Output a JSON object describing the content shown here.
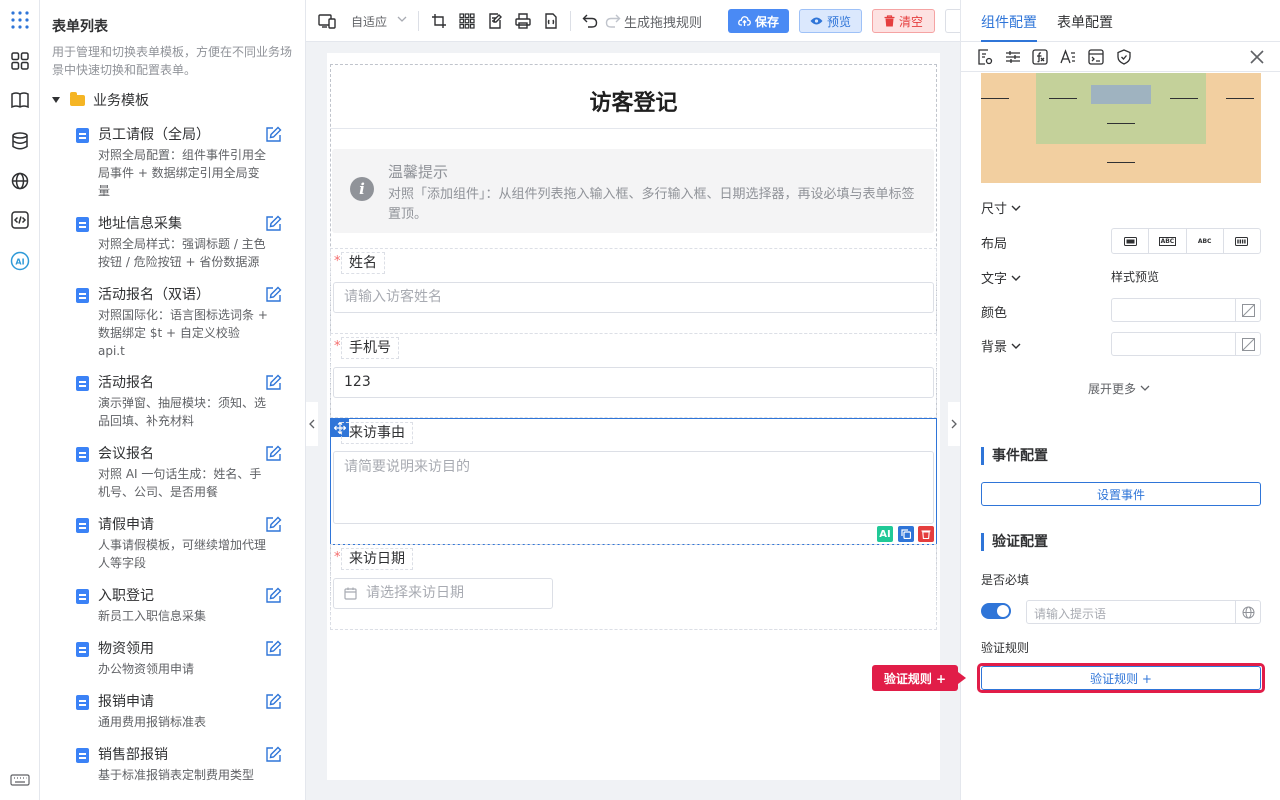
{
  "rail": {
    "icons": [
      "apps-grid-icon",
      "components-icon",
      "book-icon",
      "database-icon",
      "globe-icon",
      "code-icon",
      "ai-icon",
      "keyboard-icon"
    ],
    "ai_label": "AI"
  },
  "form_list": {
    "title": "表单列表",
    "description": "用于管理和切换表单模板，方便在不同业务场景中快速切换和配置表单。",
    "folder": "业务模板",
    "templates": [
      {
        "name": "员工请假（全局）",
        "desc": "对照全局配置：组件事件引用全局事件 + 数据绑定引用全局变量"
      },
      {
        "name": "地址信息采集",
        "desc": "对照全局样式：强调标题 / 主色按钮 / 危险按钮 + 省份数据源"
      },
      {
        "name": "活动报名（双语）",
        "desc": "对照国际化：语言图标选词条 + 数据绑定 $t + 自定义校验 api.t"
      },
      {
        "name": "活动报名",
        "desc": "演示弹窗、抽屉模块：须知、选品回填、补充材料"
      },
      {
        "name": "会议报名",
        "desc": "对照 AI 一句话生成：姓名、手机号、公司、是否用餐"
      },
      {
        "name": "请假申请",
        "desc": "人事请假模板，可继续增加代理人等字段"
      },
      {
        "name": "入职登记",
        "desc": "新员工入职信息采集"
      },
      {
        "name": "物资领用",
        "desc": "办公物资领用申请"
      },
      {
        "name": "报销申请",
        "desc": "通用费用报销标准表"
      },
      {
        "name": "销售部报销",
        "desc": "基于标准报销表定制费用类型"
      }
    ]
  },
  "toolbar": {
    "adaptive_label": "自适应",
    "generate_rules": "生成拖拽规则",
    "save": "保存",
    "preview": "预览",
    "clear": "清空"
  },
  "form": {
    "title": "访客登记",
    "tip_title": "温馨提示",
    "tip_text": "对照「添加组件」：从组件列表拖入输入框、多行输入框、日期选择器，再设必填与表单标签置顶。",
    "required_mark": "*",
    "fields": {
      "name": {
        "label": "姓名",
        "placeholder": "请输入访客姓名"
      },
      "phone": {
        "label": "手机号",
        "value": "123"
      },
      "reason": {
        "label": "来访事由",
        "placeholder": "请简要说明来访目的"
      },
      "date": {
        "label": "来访日期",
        "placeholder": "请选择来访日期"
      }
    },
    "ai_label": "AI"
  },
  "right_panel": {
    "tabs": [
      "组件配置",
      "表单配置"
    ],
    "size_label": "尺寸",
    "layout_label": "布局",
    "layout_options": [
      "ABC",
      "ABC"
    ],
    "text_label": "文字",
    "style_preview": "样式预览",
    "color_label": "颜色",
    "background_label": "背景",
    "expand_more": "展开更多",
    "event_section": "事件配置",
    "set_event": "设置事件",
    "validation_section": "验证配置",
    "required_label": "是否必填",
    "required_placeholder": "请输入提示语",
    "rules_label": "验证规则",
    "rules_button": "验证规则 +",
    "callout": "验证规则 +"
  },
  "colors": {
    "primary": "#2f75d8",
    "danger": "#e11d48",
    "save_btn": "#4a8af4"
  }
}
